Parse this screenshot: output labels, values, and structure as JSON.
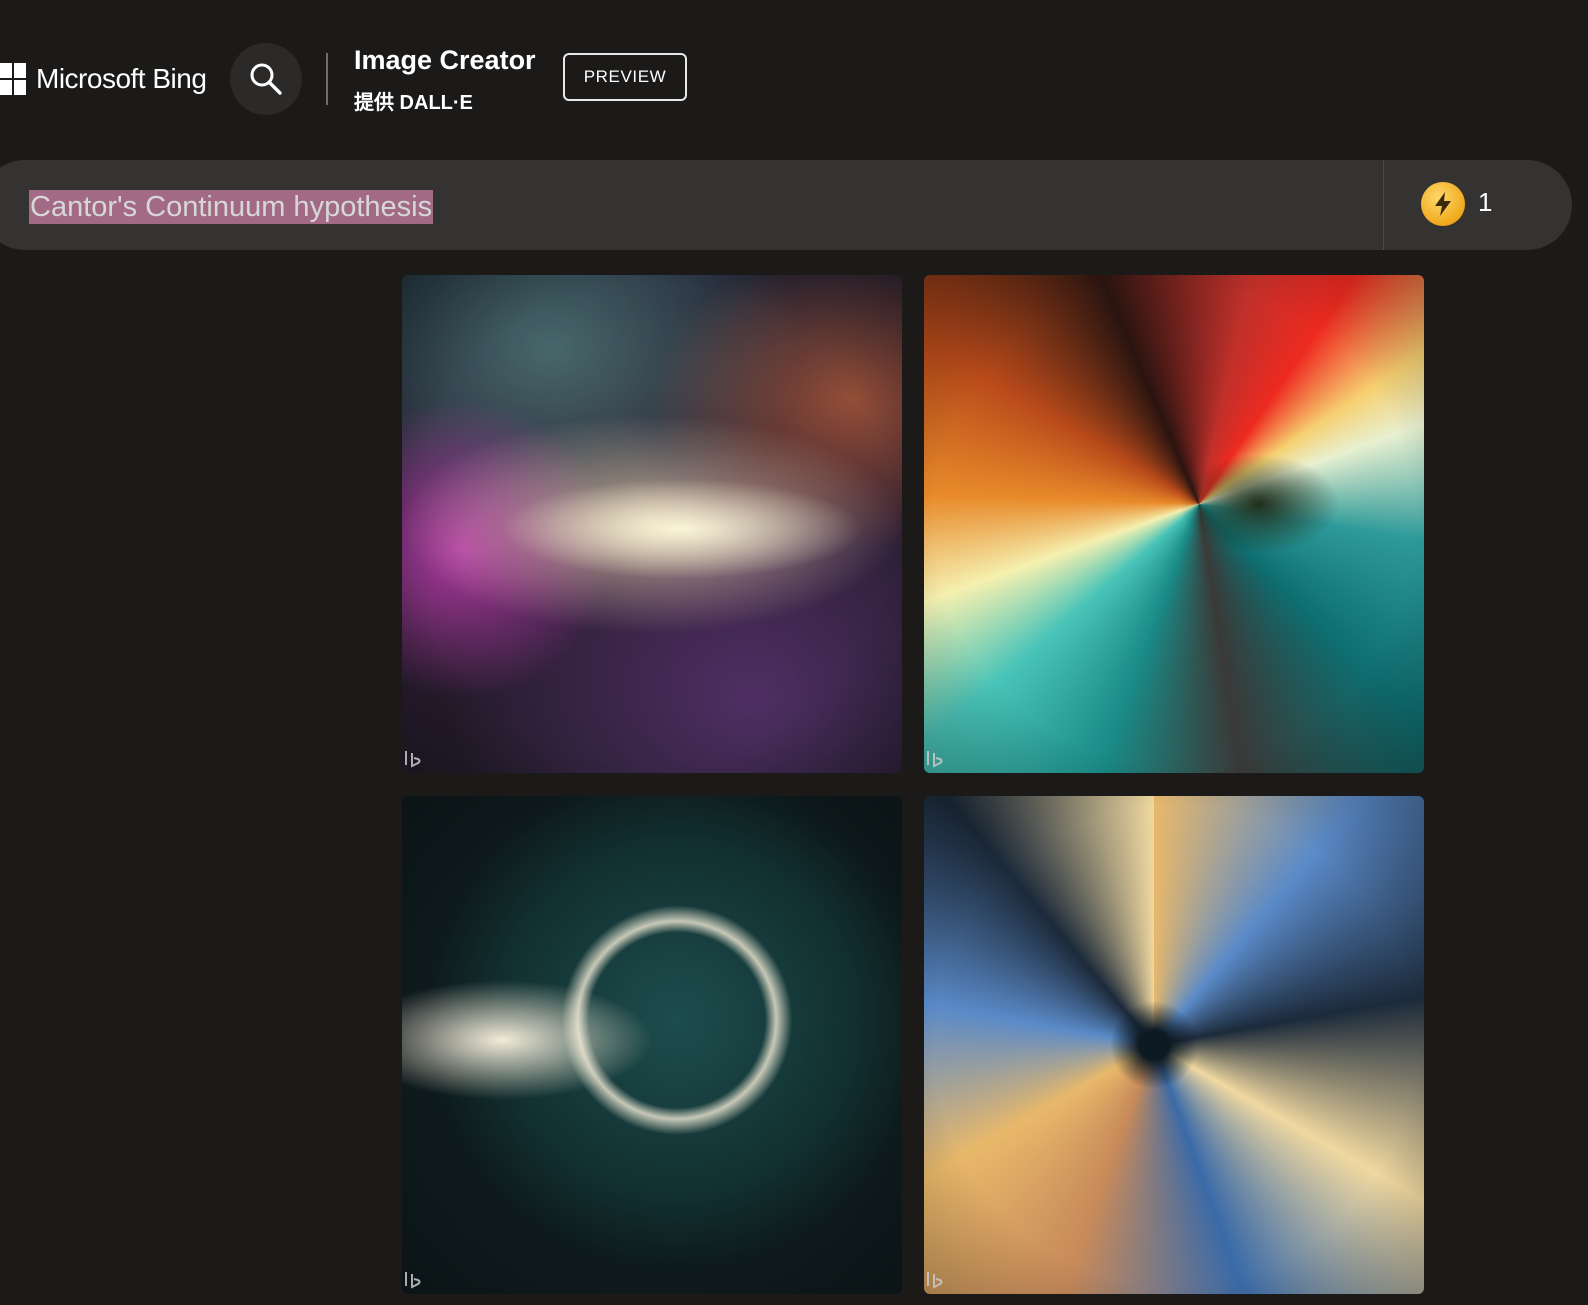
{
  "header": {
    "brand_name": "Microsoft Bing",
    "app_title": "Image Creator",
    "app_subtitle": "提供 DALL·E",
    "preview_label": "PREVIEW"
  },
  "prompt": {
    "text": "Cantor's Continuum hypothesis",
    "selection_color": "#a26a84"
  },
  "boosts": {
    "icon": "lightning-bolt-icon",
    "count": "1",
    "color": "#f0a91c"
  },
  "images": [
    {
      "name": "generated-image-1",
      "watermark_icon": "bing-logo-icon"
    },
    {
      "name": "generated-image-2",
      "watermark_icon": "bing-logo-icon"
    },
    {
      "name": "generated-image-3",
      "watermark_icon": "bing-logo-icon"
    },
    {
      "name": "generated-image-4",
      "watermark_icon": "bing-logo-icon"
    }
  ],
  "colors": {
    "background": "#1b1a19",
    "prompt_bar": "#343332",
    "search_button": "#2b2a29"
  }
}
